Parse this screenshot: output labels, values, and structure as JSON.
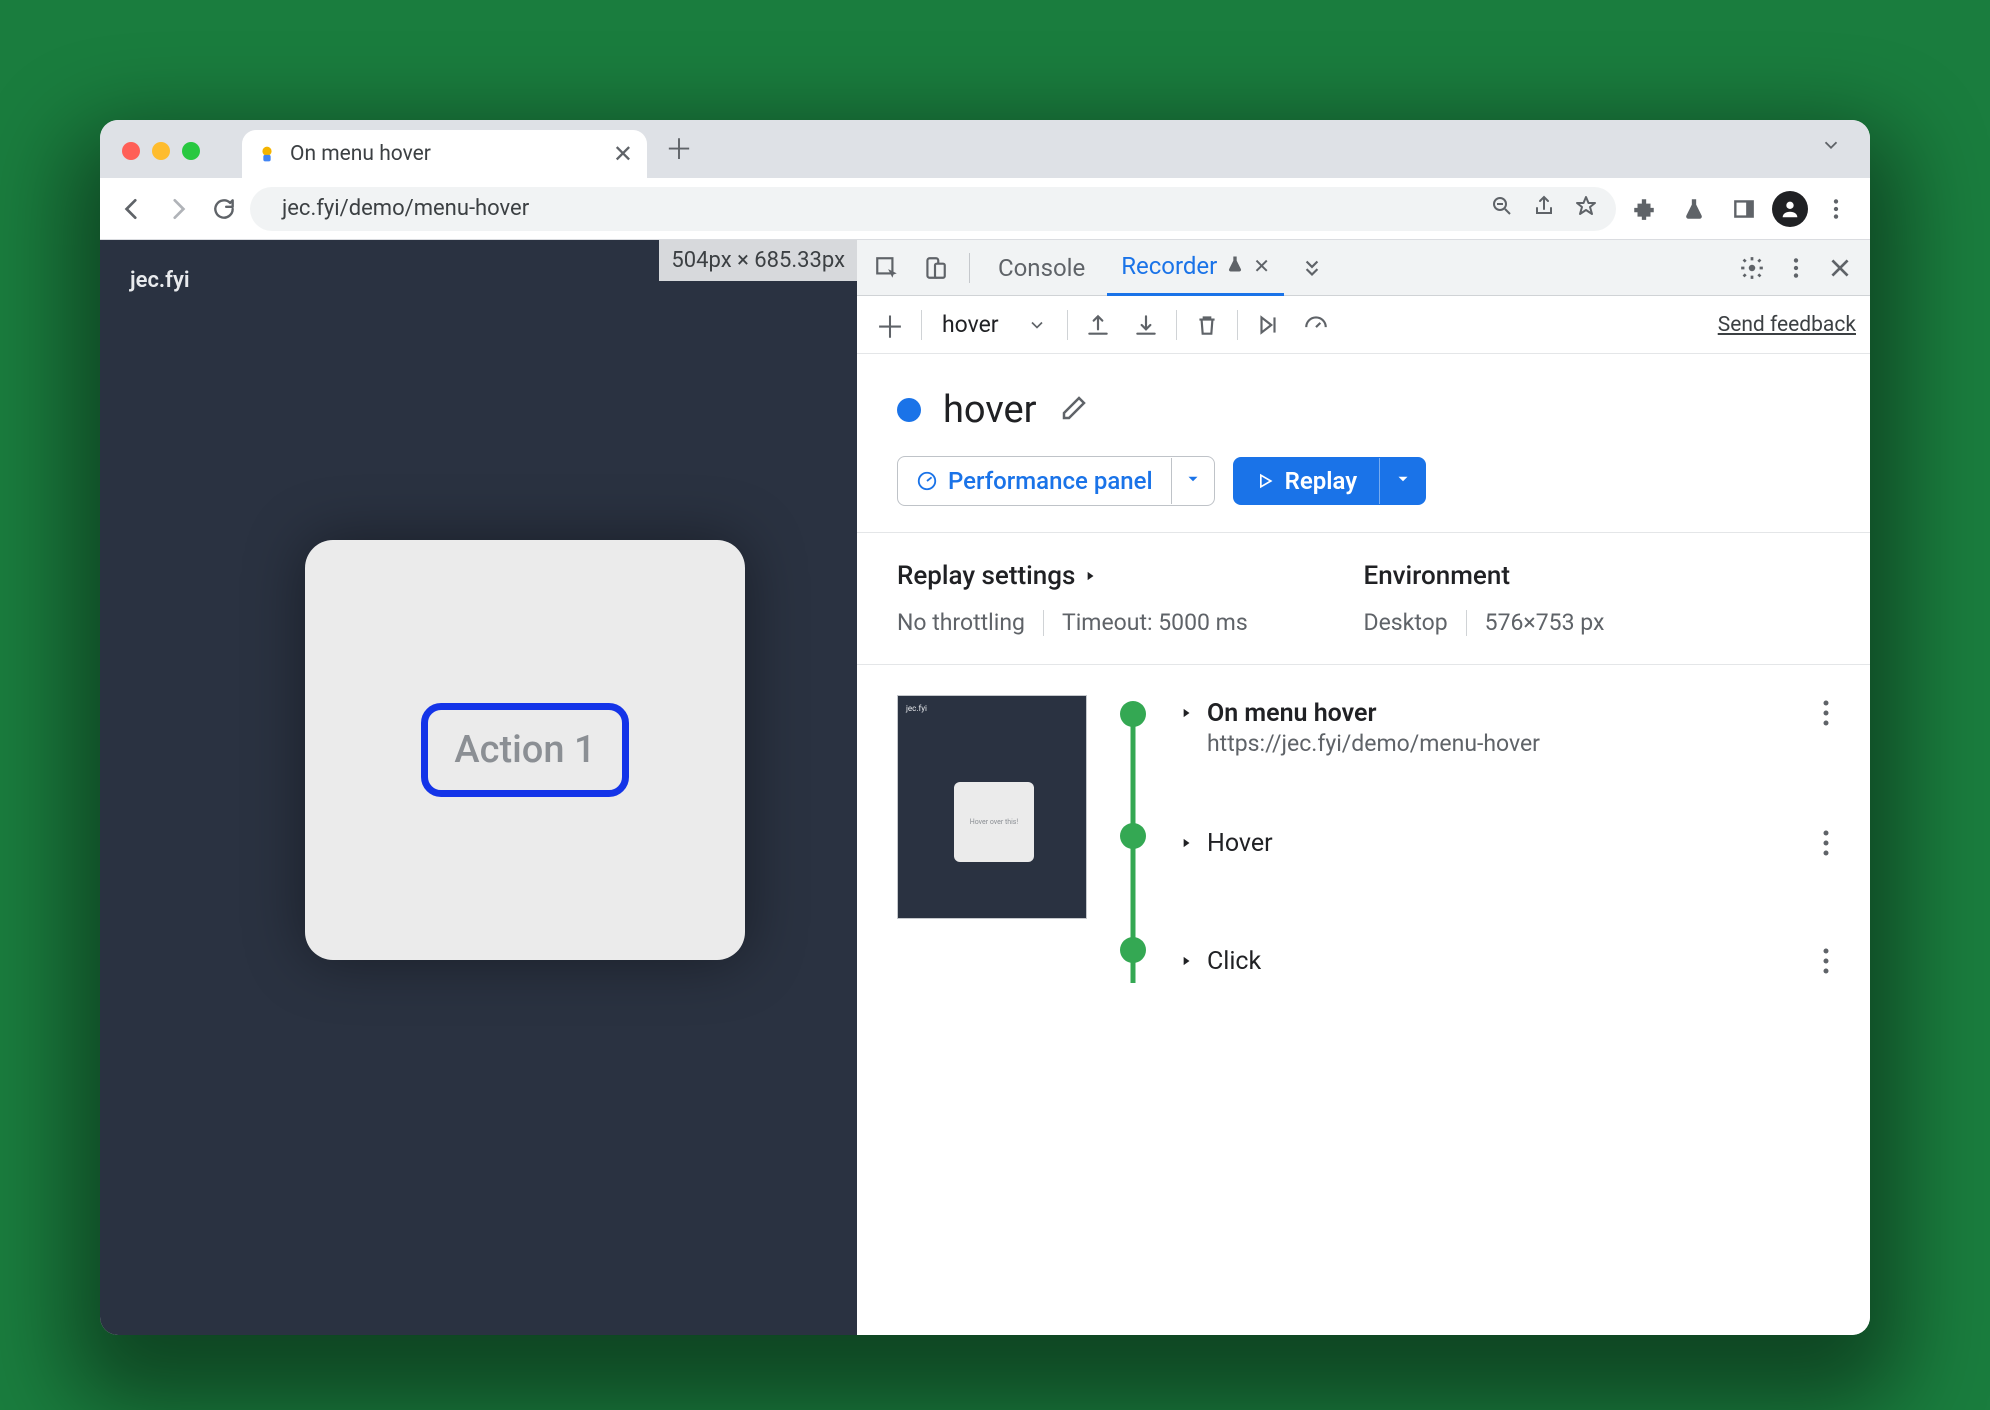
{
  "browserTab": {
    "title": "On menu hover"
  },
  "addressBar": {
    "url": "jec.fyi/demo/menu-hover"
  },
  "page": {
    "brand": "jec.fyi",
    "dimensions": "504px × 685.33px",
    "actionLabel": "Action 1"
  },
  "devtools": {
    "tabs": {
      "console": "Console",
      "recorder": "Recorder"
    },
    "feedback": "Send feedback",
    "recorder": {
      "selector": "hover",
      "recordingName": "hover",
      "perfButton": "Performance panel",
      "replayButton": "Replay",
      "replaySettingsHeader": "Replay settings",
      "environmentHeader": "Environment",
      "throttling": "No throttling",
      "timeout": "Timeout: 5000 ms",
      "device": "Desktop",
      "viewport": "576×753 px",
      "steps": {
        "thumbBrand": "jec.fyi",
        "thumbText": "Hover over this!",
        "main": {
          "title": "On menu hover",
          "url": "https://jec.fyi/demo/menu-hover"
        },
        "hover": "Hover",
        "click": "Click"
      }
    }
  }
}
